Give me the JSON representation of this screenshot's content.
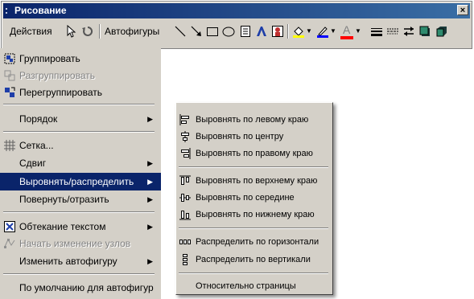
{
  "toolbar": {
    "title": "Рисование",
    "close_glyph": "×",
    "actions_label": "Действия",
    "autoshapes_label": "Автофигуры",
    "fill_color": "#ffff00",
    "line_color": "#0000ff",
    "font_color": "#ff0000",
    "font_glyph": "A"
  },
  "main_menu": {
    "items": [
      {
        "id": "group",
        "label": "Группировать",
        "icon": "group-icon"
      },
      {
        "id": "ungroup",
        "label": "Разгруппировать",
        "icon": "ungroup-icon",
        "disabled": true
      },
      {
        "id": "regroup",
        "label": "Перегруппировать",
        "icon": "regroup-icon"
      },
      {
        "id": "order",
        "label": "Порядок",
        "arrow": "▶"
      },
      {
        "id": "grid",
        "label": "Сетка...",
        "icon": "grid-icon"
      },
      {
        "id": "nudge",
        "label": "Сдвиг",
        "arrow": "▶"
      },
      {
        "id": "align",
        "label": "Выровнять/распределить",
        "arrow": "▶",
        "highlighted": true
      },
      {
        "id": "rotate",
        "label": "Повернуть/отразить",
        "arrow": "▶"
      },
      {
        "id": "wrap",
        "label": "Обтекание текстом",
        "icon": "text-wrap-icon",
        "arrow": "▶"
      },
      {
        "id": "edit_points",
        "label": "Начать изменение узлов",
        "icon": "edit-points-icon",
        "disabled": true
      },
      {
        "id": "change_shape",
        "label": "Изменить автофигуру",
        "arrow": "▶"
      },
      {
        "id": "default",
        "label": "По умолчанию для автофигур"
      }
    ]
  },
  "submenu": {
    "items": [
      {
        "id": "align_left",
        "label": "Выровнять по левому краю",
        "icon": "align-left-icon"
      },
      {
        "id": "align_center",
        "label": "Выровнять по центру",
        "icon": "align-center-icon"
      },
      {
        "id": "align_right",
        "label": "Выровнять по правому краю",
        "icon": "align-right-icon"
      },
      {
        "id": "align_top",
        "label": "Выровнять по верхнему краю",
        "icon": "align-top-icon"
      },
      {
        "id": "align_middle",
        "label": "Выровнять по середине",
        "icon": "align-middle-icon"
      },
      {
        "id": "align_bottom",
        "label": "Выровнять по нижнему краю",
        "icon": "align-bottom-icon"
      },
      {
        "id": "dist_h",
        "label": "Распределить по горизонтали",
        "icon": "distribute-horizontal-icon"
      },
      {
        "id": "dist_v",
        "label": "Распределить по вертикали",
        "icon": "distribute-vertical-icon"
      },
      {
        "id": "relative",
        "label": "Относительно страницы"
      }
    ]
  }
}
